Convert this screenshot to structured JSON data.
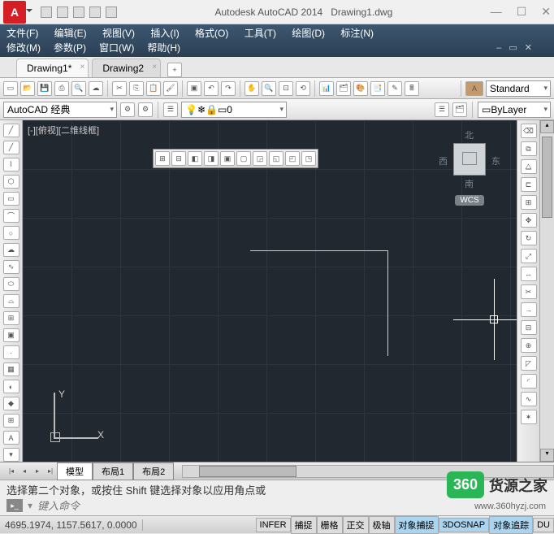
{
  "app": {
    "title_prefix": "Autodesk AutoCAD 2014",
    "doc": "Drawing1.dwg",
    "logo": "A"
  },
  "menus": {
    "row1": [
      "文件(F)",
      "编辑(E)",
      "视图(V)",
      "插入(I)",
      "格式(O)",
      "工具(T)",
      "绘图(D)",
      "标注(N)"
    ],
    "row2": [
      "修改(M)",
      "参数(P)",
      "窗口(W)",
      "帮助(H)"
    ]
  },
  "doctabs": [
    {
      "label": "Drawing1*",
      "active": true
    },
    {
      "label": "Drawing2",
      "active": false
    }
  ],
  "props": {
    "workspace": "AutoCAD 经典",
    "layer": "0",
    "style": "Standard",
    "color": "ByLayer",
    "textstyle": "A"
  },
  "canvas": {
    "view_label": "[-][俯视][二维线框]",
    "compass": {
      "n": "北",
      "e": "东",
      "s": "南",
      "w": "西"
    },
    "wcs": "WCS",
    "y": "Y",
    "x": "X"
  },
  "layout": {
    "tabs": [
      "模型",
      "布局1",
      "布局2"
    ]
  },
  "command": {
    "history": "选择第二个对象，或按住 Shift 键选择对象以应用角点或",
    "prompt": "键入命令"
  },
  "status": {
    "coords": "4695.1974, 1157.5617, 0.0000",
    "buttons": [
      "INFER",
      "捕捉",
      "栅格",
      "正交",
      "极轴",
      "对象捕捉",
      "3DOSNAP",
      "对象追踪",
      "DU"
    ],
    "active": [
      5,
      6,
      7
    ]
  },
  "watermark": {
    "badge": "360",
    "text": "货源之家",
    "url": "www.360hyzj.com"
  }
}
